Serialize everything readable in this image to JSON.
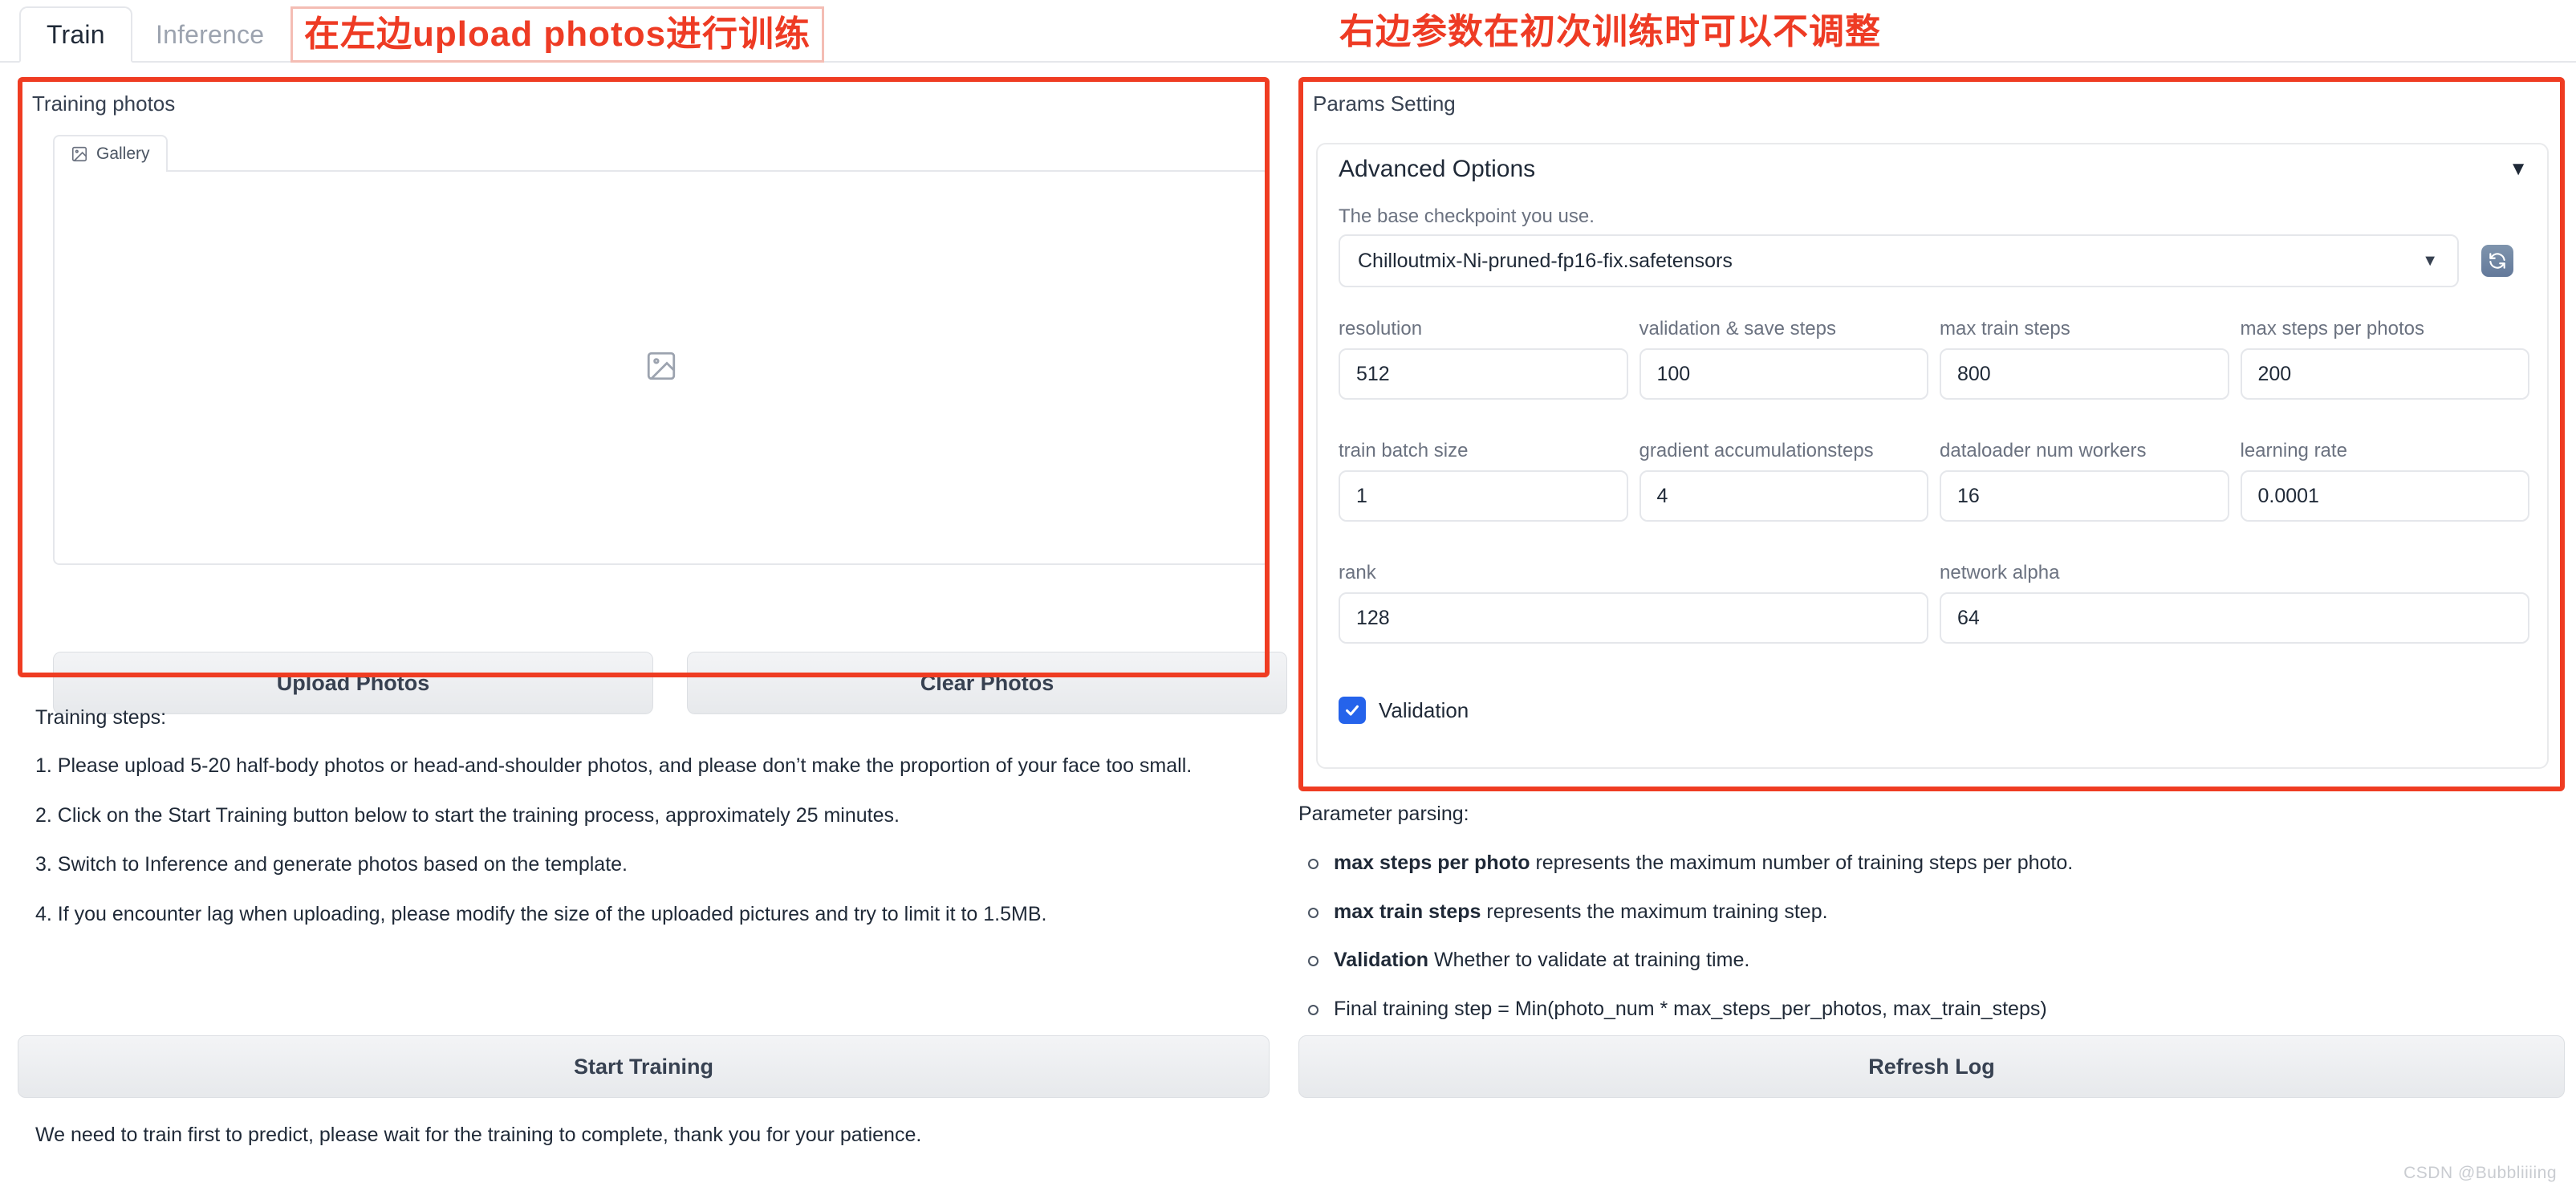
{
  "tabs": [
    {
      "label": "Train",
      "active": true
    },
    {
      "label": "Inference",
      "active": false
    }
  ],
  "annotations": {
    "left": "在左边upload photos进行训练",
    "right": "右边参数在初次训练时可以不调整",
    "color": "#ee3b24"
  },
  "left_panel": {
    "label": "Training photos",
    "gallery_tab": "Gallery",
    "gallery_icon": "image-placeholder-icon",
    "upload_button": "Upload Photos",
    "clear_button": "Clear Photos",
    "steps_title": "Training steps:",
    "steps": [
      "1. Please upload 5-20 half-body photos or head-and-shoulder photos, and please don’t make the proportion of your face too small.",
      "2. Click on the Start Training button below to start the training process, approximately 25 minutes.",
      "3. Switch to Inference and generate photos based on the template.",
      "4. If you encounter lag when uploading, please modify the size of the uploaded pictures and try to limit it to 1.5MB."
    ],
    "start_training_button": "Start Training",
    "footnote": "We need to train first to predict, please wait for the training to complete, thank you for your patience."
  },
  "right_panel": {
    "label": "Params Setting",
    "advanced_options_title": "Advanced Options",
    "advanced_options_caret": "▼",
    "checkpoint_hint": "The base checkpoint you use.",
    "checkpoint_value": "Chilloutmix-Ni-pruned-fp16-fix.safetensors",
    "checkpoint_caret": "▼",
    "refresh_icon": "refresh-icon",
    "params_rows": [
      [
        {
          "label": "resolution",
          "value": "512"
        },
        {
          "label": "validation & save steps",
          "value": "100"
        },
        {
          "label": "max train steps",
          "value": "800"
        },
        {
          "label": "max steps per photos",
          "value": "200"
        }
      ],
      [
        {
          "label": "train batch size",
          "value": "1"
        },
        {
          "label": "gradient accumulationsteps",
          "value": "4"
        },
        {
          "label": "dataloader num workers",
          "value": "16"
        },
        {
          "label": "learning rate",
          "value": "0.0001"
        }
      ],
      [
        {
          "label": "rank",
          "value": "128"
        },
        {
          "label": "network alpha",
          "value": "64"
        }
      ]
    ],
    "validation_label": "Validation",
    "validation_checked": true,
    "validation_color": "#2563eb",
    "parsing_title": "Parameter parsing:",
    "parsing_items": [
      {
        "bold": "max steps per photo",
        "rest": " represents the maximum number of training steps per photo."
      },
      {
        "bold": "max train steps",
        "rest": " represents the maximum training step."
      },
      {
        "bold": "Validation",
        "rest": " Whether to validate at training time."
      },
      {
        "bold": "",
        "rest": "Final training step = Min(photo_num * max_steps_per_photos, max_train_steps)"
      }
    ],
    "refresh_log_button": "Refresh Log"
  },
  "watermark": "CSDN @Bubbliiiing"
}
